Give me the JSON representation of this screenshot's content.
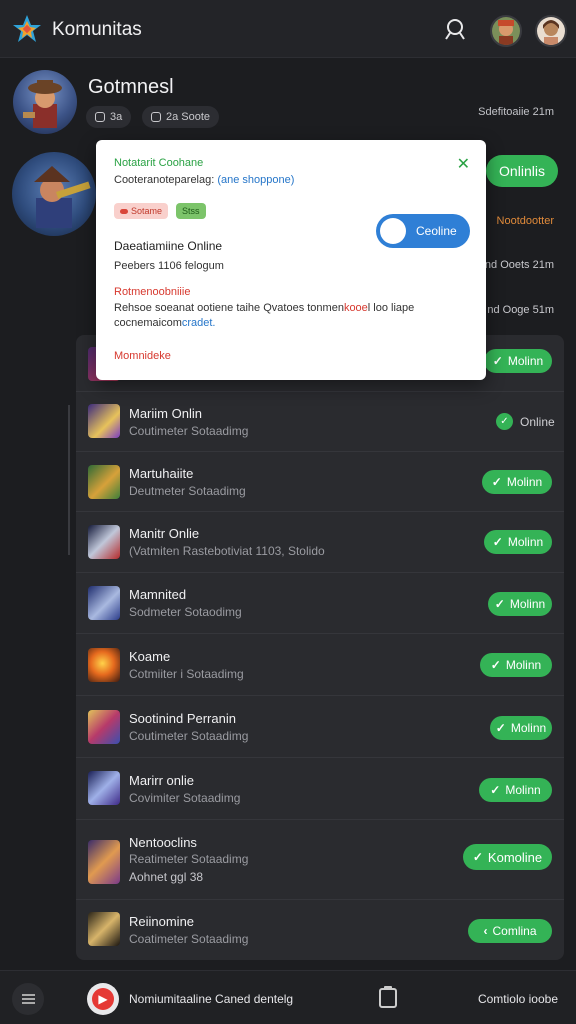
{
  "app": {
    "title": "Komunitas"
  },
  "profile": {
    "name": "Gotmnesl",
    "chip1": "3a",
    "chip2": "2a Soote",
    "date": "Sdefitoaiie 21m"
  },
  "row2": {
    "online_label": "Onlinlis",
    "side_text_1": "Nootdootter",
    "side_text_2": "nd Ooets 21m",
    "side_text_3": "nd Ooge 51m"
  },
  "popup": {
    "title": "Notatarit Coohane",
    "subtitle": "Cooteranoteparelag:",
    "subtitle_link": "(ane shoppone)",
    "tag_red": "Sotame",
    "tag_green": "Stss",
    "toggle_label": "Ceoline",
    "heading": "Daeatiamiine Online",
    "text": "Peebers 1106  felogum",
    "red_heading": "Rotmenoobniiie",
    "desc_a": "Rehsoe soeanat ootiene taihe  Qvatoes tonmen",
    "desc_red": "kooe",
    "desc_b": "l loo liape",
    "desc_line2": "cocnemaicom",
    "desc_link": "cradet.",
    "footer": "Momnideke"
  },
  "list": [
    {
      "title": "",
      "subtitle": "",
      "subtitle2": "",
      "status": "Molinn"
    },
    {
      "title": "Mariim Onlin",
      "subtitle": "Coutimeter Sotaadimg",
      "subtitle2": "",
      "status": "Online"
    },
    {
      "title": "Martuhaiite",
      "subtitle": "Deutmeter Sotaadimg",
      "subtitle2": "",
      "status": "Molinn"
    },
    {
      "title": "Manitr Onlie",
      "subtitle": "(Vatmiten Rastebotiviat 1103, Stolido",
      "subtitle2": "",
      "status": "Molinn"
    },
    {
      "title": "Mamnited",
      "subtitle": "Sodmeter Sotaodimg",
      "subtitle2": "",
      "status": "Molinn"
    },
    {
      "title": "Koame",
      "subtitle": "Cotmiiter i Sotaadimg",
      "subtitle2": "",
      "status": "Molinn"
    },
    {
      "title": "Sootinind Perranin",
      "subtitle": "Coutimeter Sotaadimg",
      "subtitle2": "",
      "status": "Molinn"
    },
    {
      "title": "Marirr onlie",
      "subtitle": "Covimiter Sotaadimg",
      "subtitle2": "",
      "status": "Molinn"
    },
    {
      "title": "Nentooclins",
      "subtitle": "Reatimeter Sotaadimg",
      "subtitle2": "Aohnet ggl 38",
      "status": "Komoline"
    },
    {
      "title": "Reiinomine",
      "subtitle": "Coatimeter Sotaadimg",
      "subtitle2": "",
      "status": "Comlina"
    }
  ],
  "bottom": {
    "status_text": "Nomiumitaaline Caned dentelg",
    "right_text": "Comtiolo ioobe"
  }
}
